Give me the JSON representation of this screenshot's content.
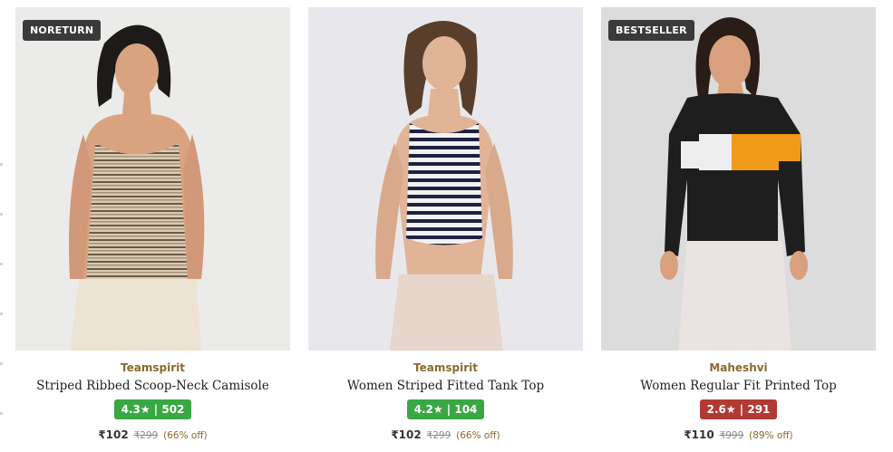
{
  "colors": {
    "rating_green": "#3aa745",
    "rating_red": "#b23a34",
    "badge_bg": "#3a3a3a",
    "brand": "#8a6a2e"
  },
  "products": [
    {
      "badge": "NORETURN",
      "brand": "Teamspirit",
      "title": "Striped Ribbed Scoop-Neck Camisole",
      "rating": "4.3★ | 502",
      "rating_color": "green",
      "price": "₹102",
      "mrp": "₹299",
      "discount": "(66% off)"
    },
    {
      "badge": "",
      "brand": "Teamspirit",
      "title": "Women Striped Fitted Tank Top",
      "rating": "4.2★ | 104",
      "rating_color": "green",
      "price": "₹102",
      "mrp": "₹299",
      "discount": "(66% off)"
    },
    {
      "badge": "BESTSELLER",
      "brand": "Maheshvi",
      "title": "Women Regular Fit Printed Top",
      "rating": "2.6★ | 291",
      "rating_color": "red",
      "price": "₹110",
      "mrp": "₹999",
      "discount": "(89% off)"
    }
  ]
}
